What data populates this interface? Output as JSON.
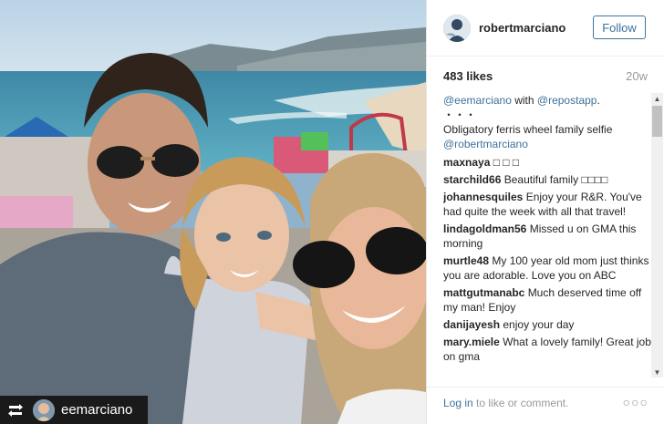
{
  "photo": {
    "alt_icon": "family-selfie-photo",
    "repost_icon": "repost-icon",
    "repost_username": "eemarciano"
  },
  "header": {
    "username": "robertmarciano",
    "follow_label": "Follow"
  },
  "stats": {
    "likes": "483 likes",
    "age": "20w"
  },
  "caption": {
    "mention": "@eemarciano",
    "with_text": " with ",
    "app": "@repostapp",
    "dot": ".",
    "ellipsis": "・・・",
    "body": "Obligatory ferris wheel family selfie",
    "tag": "@robertmarciano"
  },
  "comments": [
    {
      "author": "maxnaya",
      "text": "□ □ □"
    },
    {
      "author": "starchild66",
      "text": "Beautiful family □□□□"
    },
    {
      "author": "johannesquiles",
      "text": "Enjoy your R&R. You've had quite the week with all that travel!"
    },
    {
      "author": "lindagoldman56",
      "text": "Missed u on GMA this morning"
    },
    {
      "author": "murtle48",
      "text": "My 100 year old mom just thinks you are adorable. Love you on ABC"
    },
    {
      "author": "mattgutmanabc",
      "text": "Much deserved time off my man! Enjoy"
    },
    {
      "author": "danijayesh",
      "text": "enjoy your day"
    },
    {
      "author": "mary.miele",
      "text": "What a lovely family! Great job on gma"
    }
  ],
  "footer": {
    "login_link": "Log in",
    "login_rest": " to like or comment.",
    "more": "○○○"
  },
  "colors": {
    "link": "#3f729b",
    "muted": "#999999",
    "text": "#262626"
  }
}
